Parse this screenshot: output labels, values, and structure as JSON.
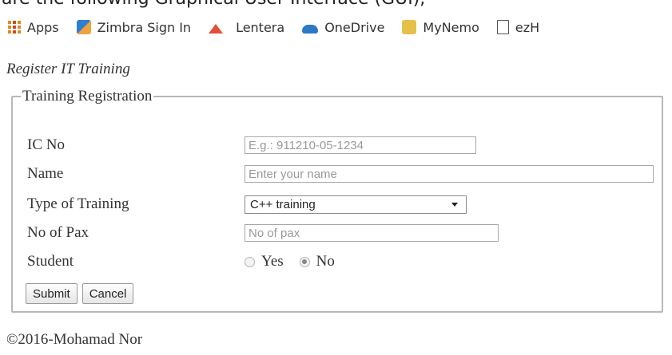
{
  "caption_strip": "are the following Graphical User Interface (GUI),",
  "bookmarks": [
    {
      "label": "Apps",
      "icon": "apps-grid-icon"
    },
    {
      "label": "Zimbra Sign In",
      "icon": "zimbra-icon"
    },
    {
      "label": "Lentera",
      "icon": "lentera-icon"
    },
    {
      "label": "OneDrive",
      "icon": "onedrive-cloud-icon"
    },
    {
      "label": "MyNemo",
      "icon": "mynemo-icon"
    },
    {
      "label": "ezH",
      "icon": "page-icon"
    }
  ],
  "page": {
    "heading": "Register IT Training",
    "fieldset_legend": "Training Registration"
  },
  "form": {
    "ic_no": {
      "label": "IC No",
      "value": "",
      "placeholder": "E.g.: 911210-05-1234"
    },
    "name": {
      "label": "Name",
      "value": "",
      "placeholder": "Enter your name"
    },
    "training_type": {
      "label": "Type of Training",
      "selected": "C++ training"
    },
    "no_of_pax": {
      "label": "No of Pax",
      "value": "",
      "placeholder": "No of pax"
    },
    "student": {
      "label": "Student",
      "options": [
        {
          "label": "Yes",
          "checked": false
        },
        {
          "label": "No",
          "checked": true
        }
      ]
    },
    "submit_label": "Submit",
    "cancel_label": "Cancel"
  },
  "footer": "©2016-Mohamad Nor"
}
